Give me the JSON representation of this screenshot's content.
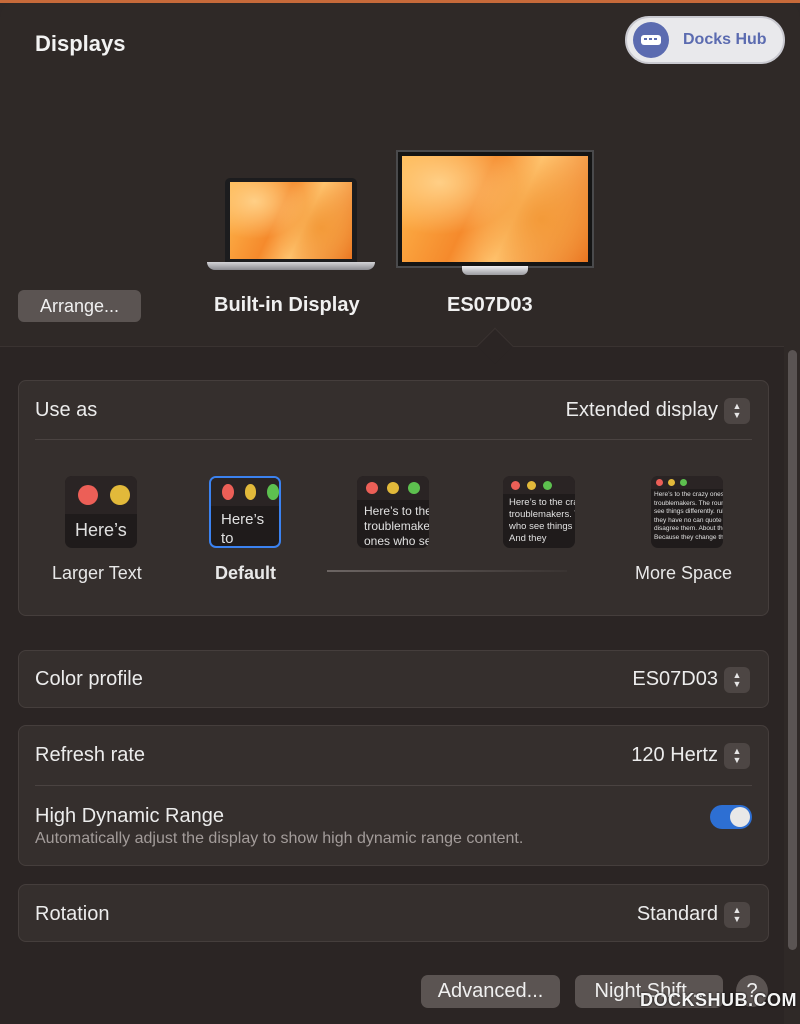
{
  "header": {
    "title": "Displays"
  },
  "badge": {
    "label": "Docks Hub"
  },
  "displays": {
    "arrange_label": "Arrange...",
    "items": [
      {
        "name": "Built-in Display",
        "selected": false
      },
      {
        "name": "ES07D03",
        "selected": true
      }
    ]
  },
  "use_as": {
    "label": "Use as",
    "value": "Extended display",
    "resolutions": [
      {
        "label": "Larger Text",
        "preview": "Here’s",
        "selected": false
      },
      {
        "label": "Default",
        "preview": "Here’s to troublem",
        "selected": true
      },
      {
        "label": "",
        "preview": "Here’s to the troublemakers, ones who see",
        "selected": false
      },
      {
        "label": "",
        "preview": "Here’s to the crazy troublemakers. The ones who see things rules. And they",
        "selected": false
      },
      {
        "label": "More Space",
        "preview": "Here’s to the crazy ones. troublemakers. The round ones who see things differently. rules. And they have no can quote them, disagree them. About the only thing Because they change things",
        "selected": false
      }
    ]
  },
  "color_profile": {
    "label": "Color profile",
    "value": "ES07D03"
  },
  "refresh_rate": {
    "label": "Refresh rate",
    "value": "120 Hertz"
  },
  "hdr": {
    "label": "High Dynamic Range",
    "description": "Automatically adjust the display to show high dynamic range content.",
    "enabled": true
  },
  "rotation": {
    "label": "Rotation",
    "value": "Standard"
  },
  "footer": {
    "advanced_label": "Advanced...",
    "night_shift_label": "Night Shift...",
    "help_label": "?"
  },
  "watermark": "DOCKSHUB.COM",
  "colors": {
    "accent": "#2d6fd3",
    "badge_text": "#5b6bb0",
    "traffic_red": "#ec5f57",
    "traffic_yellow": "#e2b93a",
    "traffic_green": "#5dc04f"
  }
}
